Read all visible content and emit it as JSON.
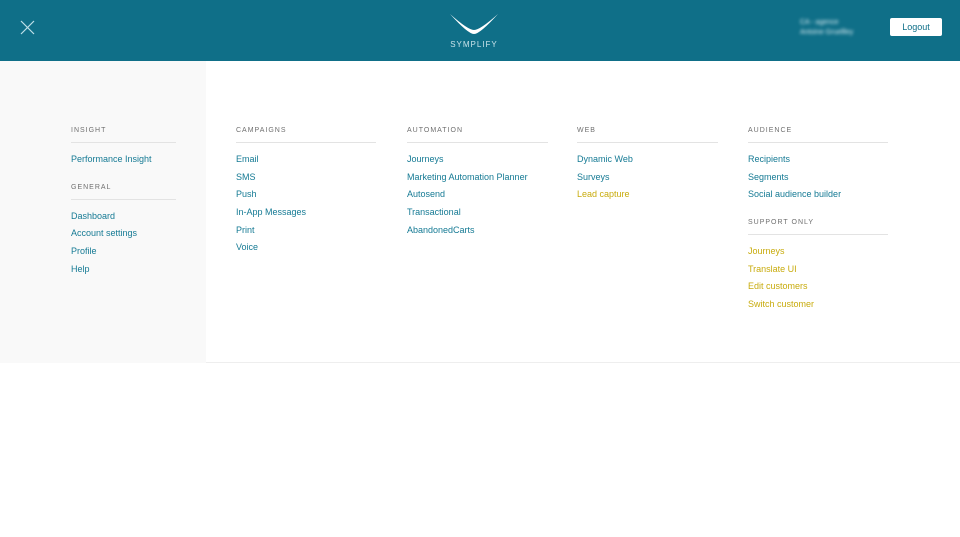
{
  "header": {
    "logo_text": "SYMPLIFY",
    "user_line1": "CA - agence",
    "user_line2": "Antoine Gruellley",
    "logout_label": "Logout",
    "close_icon": "close-icon",
    "colors": {
      "bar": "#0f6f88",
      "link": "#157a94",
      "support_link": "#c8ab0c"
    }
  },
  "columns": [
    {
      "sections": [
        {
          "title": "INSIGHT",
          "items": [
            {
              "label": "Performance Insight",
              "support": false
            }
          ]
        },
        {
          "title": "GENERAL",
          "items": [
            {
              "label": "Dashboard",
              "support": false
            },
            {
              "label": "Account settings",
              "support": false
            },
            {
              "label": "Profile",
              "support": false
            },
            {
              "label": "Help",
              "support": false
            }
          ]
        }
      ]
    },
    {
      "sections": [
        {
          "title": "CAMPAIGNS",
          "items": [
            {
              "label": "Email",
              "support": false
            },
            {
              "label": "SMS",
              "support": false
            },
            {
              "label": "Push",
              "support": false
            },
            {
              "label": "In-App Messages",
              "support": false
            },
            {
              "label": "Print",
              "support": false
            },
            {
              "label": "Voice",
              "support": false
            }
          ]
        }
      ]
    },
    {
      "sections": [
        {
          "title": "AUTOMATION",
          "items": [
            {
              "label": "Journeys",
              "support": false
            },
            {
              "label": "Marketing Automation Planner",
              "support": false
            },
            {
              "label": "Autosend",
              "support": false
            },
            {
              "label": "Transactional",
              "support": false
            },
            {
              "label": "AbandonedCarts",
              "support": false
            }
          ]
        }
      ]
    },
    {
      "sections": [
        {
          "title": "WEB",
          "items": [
            {
              "label": "Dynamic Web",
              "support": false
            },
            {
              "label": "Surveys",
              "support": false
            },
            {
              "label": "Lead capture",
              "support": true
            }
          ]
        }
      ]
    },
    {
      "sections": [
        {
          "title": "AUDIENCE",
          "items": [
            {
              "label": "Recipients",
              "support": false
            },
            {
              "label": "Segments",
              "support": false
            },
            {
              "label": "Social audience builder",
              "support": false
            }
          ]
        },
        {
          "title": "SUPPORT ONLY",
          "items": [
            {
              "label": "Journeys",
              "support": true
            },
            {
              "label": "Translate UI",
              "support": true
            },
            {
              "label": "Edit customers",
              "support": true
            },
            {
              "label": "Switch customer",
              "support": true
            }
          ]
        }
      ]
    }
  ]
}
